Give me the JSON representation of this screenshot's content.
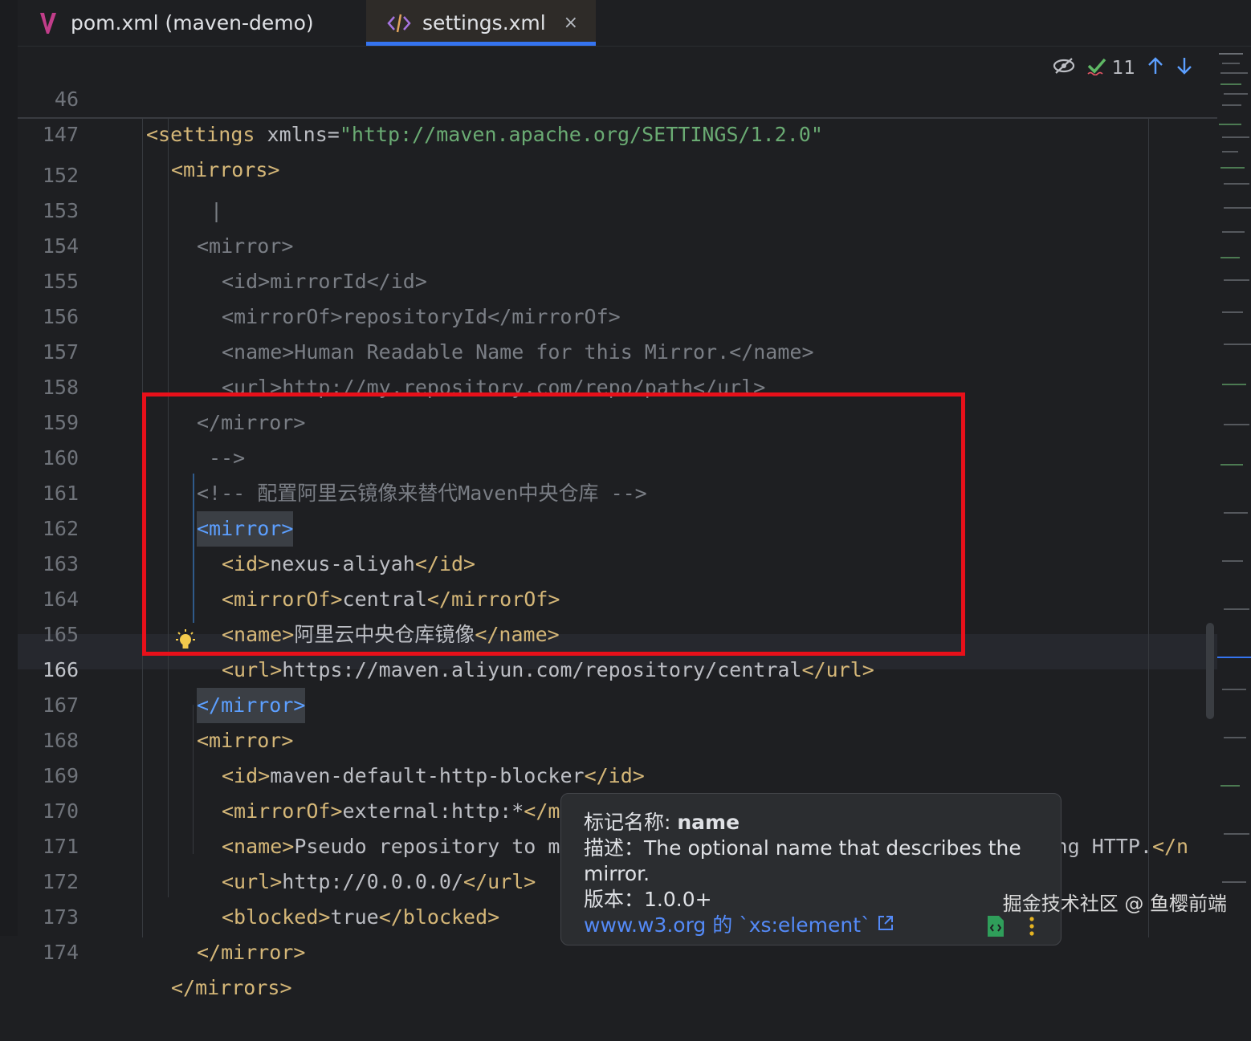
{
  "tabs": [
    {
      "label": "pom.xml (maven-demo)",
      "active": false,
      "icon": "maven-icon"
    },
    {
      "label": "settings.xml",
      "active": true,
      "icon": "xml-code-icon",
      "close": "×"
    }
  ],
  "inspection": {
    "count": "11"
  },
  "sticky_lines": [
    {
      "num": "46",
      "text": "<settings xmlns=\"http://maven.apache.org/SETTINGS/1.2.0\""
    },
    {
      "num": "147",
      "text": "<mirrors>"
    }
  ],
  "lines": [
    {
      "num": "152",
      "text": "|"
    },
    {
      "num": "153",
      "text": "<mirror>"
    },
    {
      "num": "154",
      "text": "<id>mirrorId</id>"
    },
    {
      "num": "155",
      "text": "<mirrorOf>repositoryId</mirrorOf>"
    },
    {
      "num": "156",
      "text": "<name>Human Readable Name for this Mirror.</name>"
    },
    {
      "num": "157",
      "text": "<url>http://my.repository.com/repo/path</url>"
    },
    {
      "num": "158",
      "text": "</mirror>"
    },
    {
      "num": "159",
      "text": "-->"
    },
    {
      "num": "160",
      "text": "<!-- 配置阿里云镜像来替代Maven中央仓库 -->"
    },
    {
      "num": "161",
      "text": "<mirror>"
    },
    {
      "num": "162",
      "text": "<id>nexus-aliyah</id>"
    },
    {
      "num": "163",
      "text": "<mirrorOf>central</mirrorOf>"
    },
    {
      "num": "164",
      "text": "<name>阿里云中央仓库镜像</name>"
    },
    {
      "num": "165",
      "text": "<url>https://maven.aliyun.com/repository/central</url>"
    },
    {
      "num": "166",
      "text": "</mirror>"
    },
    {
      "num": "167",
      "text": "<mirror>"
    },
    {
      "num": "168",
      "text": "<id>maven-default-http-blocker</id>"
    },
    {
      "num": "169",
      "text": "<mirrorOf>external:http:*</mirrorOf>"
    },
    {
      "num": "170",
      "text": "<name>Pseudo repository to mirror external repositories initially using HTTP.</n"
    },
    {
      "num": "171",
      "text": "<url>http://0.0.0.0/</url>"
    },
    {
      "num": "172",
      "text": "<blocked>true</blocked>"
    },
    {
      "num": "173",
      "text": "</mirror>"
    },
    {
      "num": "174",
      "text": "</mirrors>"
    }
  ],
  "tooltip": {
    "tag_label": "标记名称: ",
    "tag_name": "name",
    "desc": "描述：The optional name that describes the mirror.",
    "version": "版本：1.0.0+",
    "link": "www.w3.org 的 `xs:element`"
  },
  "watermark": "掘金技术社区 @ 鱼樱前端",
  "colors": {
    "tag": "#d5b778",
    "tag_highlight": "#5c9fff",
    "string": "#6aab73",
    "comment": "#7a7e85",
    "highlight_box": "#e8101a",
    "accent": "#3574f0"
  }
}
